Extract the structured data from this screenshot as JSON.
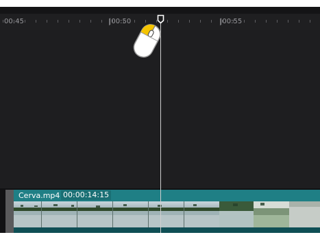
{
  "timeline": {
    "ruler_labels": [
      "00:45",
      "|00:50",
      "|00:55"
    ],
    "clip": {
      "name": "Cerva.mp4",
      "duration": "00:00:14:15"
    }
  },
  "icons": {
    "playhead_handle": "playhead-marker-icon",
    "mouse": "mouse-left-click-icon"
  },
  "colors": {
    "background": "#1e1e20",
    "clip_teal": "#1d8a8f",
    "playhead": "#cfcfcf",
    "mouse_highlight": "#f5c400"
  }
}
